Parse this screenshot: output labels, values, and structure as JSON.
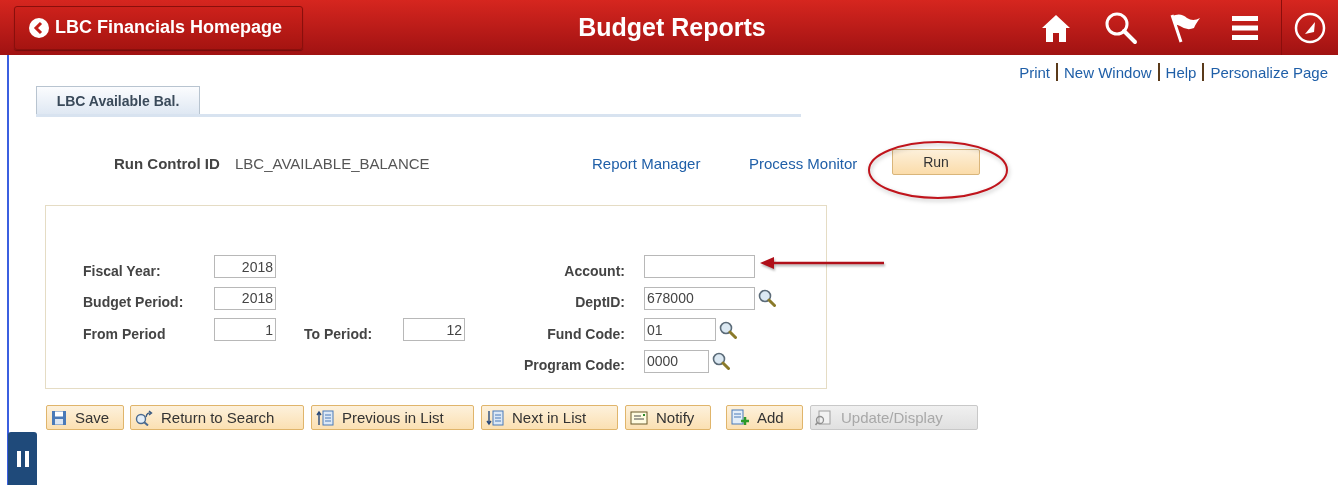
{
  "header": {
    "back_button": "LBC Financials Homepage",
    "title": "Budget Reports"
  },
  "page_links": [
    "Print",
    "New Window",
    "Help",
    "Personalize Page"
  ],
  "tabs": [
    {
      "label": "LBC Available Bal.",
      "selected": true
    }
  ],
  "run_control": {
    "label": "Run Control ID",
    "value": "LBC_AVAILABLE_BALANCE",
    "links": [
      "Report Manager",
      "Process Monitor"
    ],
    "run_button": "Run"
  },
  "left_fields": [
    {
      "label": "Fiscal Year:",
      "value": "2018"
    },
    {
      "label": "Budget Period:",
      "value": "2018"
    },
    {
      "label": "From Period",
      "value": "1",
      "pair": {
        "label": "To Period:",
        "value": "12"
      }
    }
  ],
  "right_fields": [
    {
      "label": "Account:",
      "lookup": false
    },
    {
      "label": "DeptID:",
      "value": "678000",
      "lookup": true
    },
    {
      "label": "Fund Code:",
      "value": "01",
      "lookup": true
    },
    {
      "label": "Program Code:",
      "value": "0000",
      "lookup": true
    }
  ],
  "toolbar": [
    {
      "label": "Save",
      "kind": "save",
      "disabled": false
    },
    {
      "label": "Return to Search",
      "kind": "return",
      "disabled": false
    },
    {
      "label": "Previous in List",
      "kind": "previous",
      "disabled": false
    },
    {
      "label": "Next in List",
      "kind": "next",
      "disabled": false
    },
    {
      "label": "Notify",
      "kind": "notify",
      "disabled": false
    },
    {
      "label": "Add",
      "kind": "add",
      "disabled": false
    },
    {
      "label": "Update/Display",
      "kind": "update",
      "disabled": true
    }
  ]
}
